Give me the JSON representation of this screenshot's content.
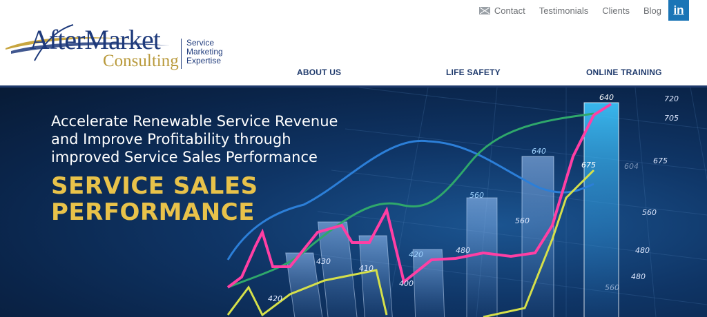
{
  "header": {
    "logo": {
      "brand_line1": "AfterMarket",
      "brand_line2": "Consulting",
      "tagline": [
        "Service",
        "Marketing",
        "Expertise"
      ]
    },
    "utility_nav": [
      {
        "label": "Contact",
        "icon": "mail-icon"
      },
      {
        "label": "Testimonials"
      },
      {
        "label": "Clients"
      },
      {
        "label": "Blog"
      }
    ],
    "social": {
      "label": "in",
      "icon": "linkedin-icon"
    },
    "main_nav": [
      {
        "label": "ABOUT US"
      },
      {
        "label": "LIFE SAFETY"
      },
      {
        "label": "ONLINE TRAINING"
      }
    ]
  },
  "hero": {
    "headline_lines": [
      "Accelerate Renewable Service Revenue",
      "and Improve Profitability through",
      "improved Service Sales Performance"
    ],
    "subhead_lines": [
      "SERVICE SALES",
      "PERFORMANCE"
    ],
    "chart_labels": [
      "720",
      "705",
      "675",
      "640",
      "604",
      "560",
      "560",
      "480",
      "430",
      "410",
      "420",
      "480",
      "400",
      "560",
      "640",
      "675",
      "480",
      "420",
      "560"
    ]
  },
  "colors": {
    "brand_blue": "#1e3a7b",
    "brand_gold": "#b99a3c",
    "nav_text": "#1f3a6c",
    "utility_text": "#6c6f73",
    "linkedin_blue": "#1b75b6",
    "hero_accent": "#e8c24a",
    "line_pink": "#ff3fa4",
    "line_green": "#2fa86b",
    "line_blue": "#2c7fd8",
    "line_yellow": "#d6e04a"
  }
}
